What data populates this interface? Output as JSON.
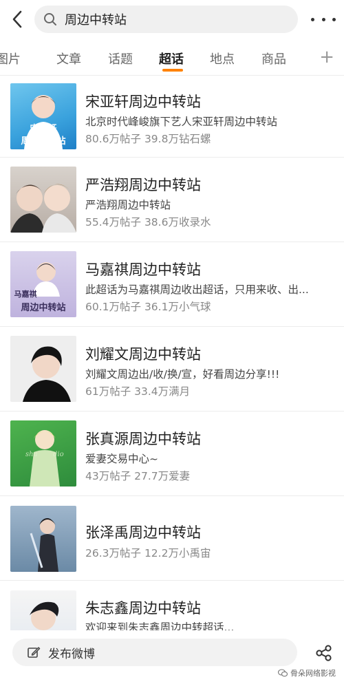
{
  "search": {
    "query": "周边中转站"
  },
  "tabs": [
    {
      "label": "图片"
    },
    {
      "label": "文章"
    },
    {
      "label": "话题"
    },
    {
      "label": "超话"
    },
    {
      "label": "地点"
    },
    {
      "label": "商品"
    }
  ],
  "active_tab": "超话",
  "tab_plus": "+",
  "items": [
    {
      "title": "宋亚轩周边中转站",
      "desc": "北京时代峰峻旗下艺人宋亚轩周边中转站",
      "stats": "80.6万帖子 39.8万钻石螺",
      "thumb_text": "宋亚轩\n周边中转站"
    },
    {
      "title": "严浩翔周边中转站",
      "desc": "严浩翔周边中转站",
      "stats": "55.4万帖子 38.6万收录水",
      "thumb_text": ""
    },
    {
      "title": "马嘉祺周边中转站",
      "desc": "此超话为马嘉祺周边收出超话，只用来收、出...",
      "stats": "60.1万帖子 36.1万小气球",
      "thumb_text": "马嘉祺\n周边中转站"
    },
    {
      "title": "刘耀文周边中转站",
      "desc": "刘耀文周边出/收/换/宣，好看周边分享!!!",
      "stats": "61万帖子 33.4万满月",
      "thumb_text": ""
    },
    {
      "title": "张真源周边中转站",
      "desc": "爱妻交易中心~",
      "stats": "43万帖子 27.7万爱妻",
      "thumb_text": ""
    },
    {
      "title": "张泽禹周边中转站",
      "desc": "",
      "stats": "26.3万帖子 12.2万小禹宙",
      "thumb_text": ""
    },
    {
      "title": "朱志鑫周边中转站",
      "desc": "欢迎来到朱志鑫周边中转超话...",
      "stats": "",
      "thumb_text": ""
    }
  ],
  "bottom": {
    "compose_label": "发布微博"
  },
  "watermark": "骨朵网络影视",
  "colors": {
    "accent": "#ff8200",
    "divider": "#ececec",
    "muted": "#888888"
  }
}
